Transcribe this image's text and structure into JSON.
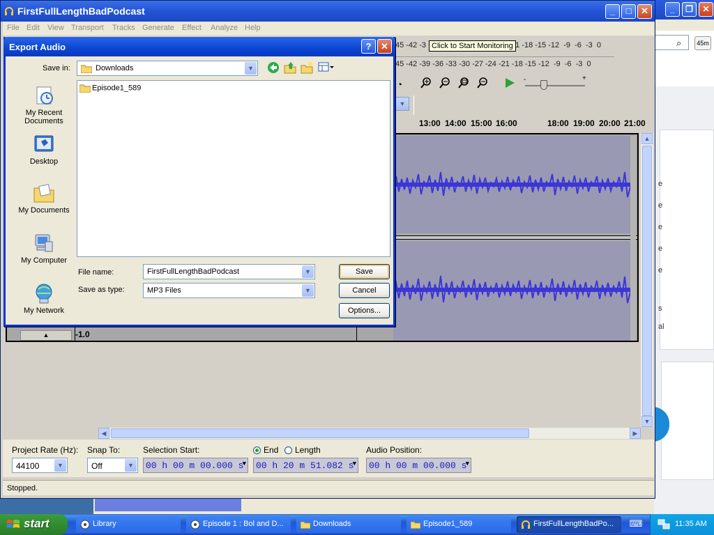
{
  "main_window": {
    "title": "FirstFullLengthBadPodcast",
    "menu": [
      "File",
      "Edit",
      "View",
      "Transport",
      "Tracks",
      "Generate",
      "Effect",
      "Analyze",
      "Help"
    ],
    "meter_top": "45 -42 -3",
    "meter_tooltip": "Click to Start Monitoring",
    "meter_top_right": "21 -18 -15 -12  -9  -6  -3  0",
    "meter_bottom": "45 -42 -39 -36 -33 -30 -27 -24 -21 -18 -15 -12  -9  -6  -3  0",
    "ruler_ticks": [
      "13:00",
      "14:00",
      "15:00",
      "16:00",
      "18:00",
      "19:00",
      "20:00",
      "21:00"
    ],
    "amplitude_label": "-1.0",
    "selection_bar": {
      "project_rate_label": "Project Rate (Hz):",
      "project_rate_value": "44100",
      "snap_to_label": "Snap To:",
      "snap_to_value": "Off",
      "selection_start_label": "Selection Start:",
      "selection_start_value": "00 h 00 m 00.000 s",
      "end_label": "End",
      "length_label": "Length",
      "end_value": "00 h 20 m 51.082 s",
      "audio_position_label": "Audio Position:",
      "audio_position_value": "00 h 00 m 00.000 s"
    },
    "status": "Stopped."
  },
  "background_window": {
    "zoom_label": "45m",
    "letters": [
      "e",
      "e",
      "e",
      "e",
      "e",
      "s",
      "al"
    ]
  },
  "dialog": {
    "title": "Export Audio",
    "help_button": "?",
    "save_in_label": "Save in:",
    "save_in_value": "Downloads",
    "places": [
      {
        "label": "My Recent Documents"
      },
      {
        "label": "Desktop"
      },
      {
        "label": "My Documents"
      },
      {
        "label": "My Computer"
      },
      {
        "label": "My Network"
      }
    ],
    "files": [
      "Episode1_589"
    ],
    "file_name_label": "File name:",
    "file_name_value": "FirstFullLengthBadPodcast",
    "save_as_type_label": "Save as type:",
    "save_as_type_value": "MP3 Files",
    "save_button": "Save",
    "cancel_button": "Cancel",
    "options_button": "Options..."
  },
  "taskbar": {
    "start_label": "start",
    "tasks": [
      {
        "label": "Library"
      },
      {
        "label": "Episode 1 : Bol and D..."
      },
      {
        "label": "Downloads"
      },
      {
        "label": "Episode1_589"
      },
      {
        "label": "FirstFullLengthBadPo..."
      }
    ],
    "clock": "11:35 AM"
  },
  "colors": {
    "titlebar_blue": "#2556d8",
    "waveform": "#3b36d6",
    "waveform_bg": "#9a99b3",
    "time_text": "#1b1bbd",
    "start_green": "#2f8a2f"
  }
}
